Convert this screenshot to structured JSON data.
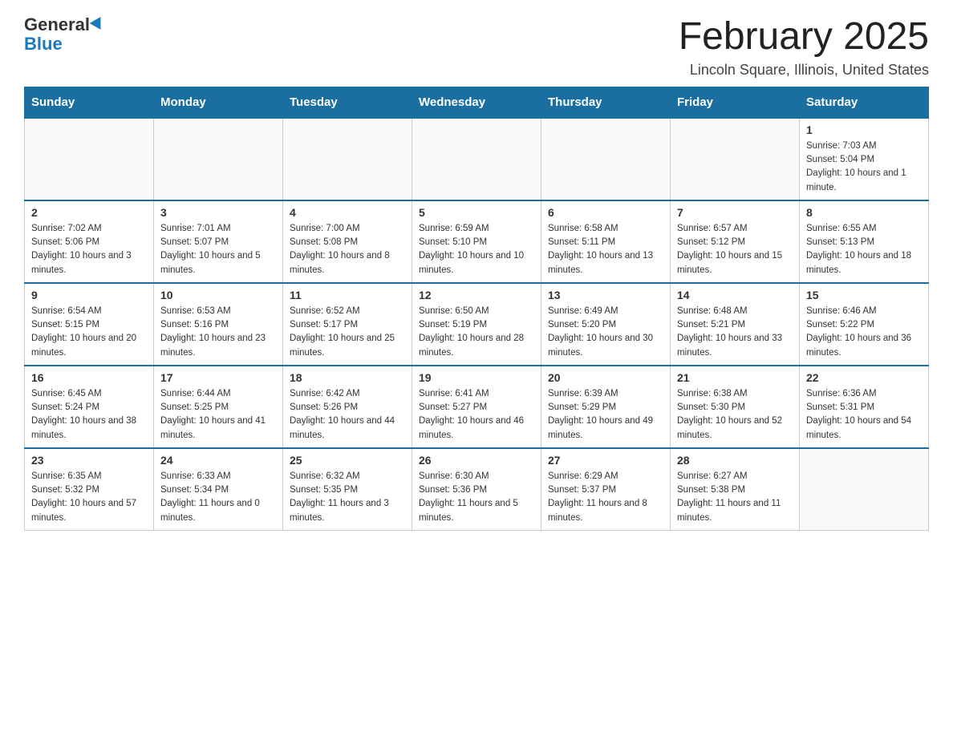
{
  "logo": {
    "name": "General",
    "name2": "Blue"
  },
  "title": "February 2025",
  "location": "Lincoln Square, Illinois, United States",
  "days_of_week": [
    "Sunday",
    "Monday",
    "Tuesday",
    "Wednesday",
    "Thursday",
    "Friday",
    "Saturday"
  ],
  "weeks": [
    [
      {
        "day": "",
        "info": ""
      },
      {
        "day": "",
        "info": ""
      },
      {
        "day": "",
        "info": ""
      },
      {
        "day": "",
        "info": ""
      },
      {
        "day": "",
        "info": ""
      },
      {
        "day": "",
        "info": ""
      },
      {
        "day": "1",
        "info": "Sunrise: 7:03 AM\nSunset: 5:04 PM\nDaylight: 10 hours and 1 minute."
      }
    ],
    [
      {
        "day": "2",
        "info": "Sunrise: 7:02 AM\nSunset: 5:06 PM\nDaylight: 10 hours and 3 minutes."
      },
      {
        "day": "3",
        "info": "Sunrise: 7:01 AM\nSunset: 5:07 PM\nDaylight: 10 hours and 5 minutes."
      },
      {
        "day": "4",
        "info": "Sunrise: 7:00 AM\nSunset: 5:08 PM\nDaylight: 10 hours and 8 minutes."
      },
      {
        "day": "5",
        "info": "Sunrise: 6:59 AM\nSunset: 5:10 PM\nDaylight: 10 hours and 10 minutes."
      },
      {
        "day": "6",
        "info": "Sunrise: 6:58 AM\nSunset: 5:11 PM\nDaylight: 10 hours and 13 minutes."
      },
      {
        "day": "7",
        "info": "Sunrise: 6:57 AM\nSunset: 5:12 PM\nDaylight: 10 hours and 15 minutes."
      },
      {
        "day": "8",
        "info": "Sunrise: 6:55 AM\nSunset: 5:13 PM\nDaylight: 10 hours and 18 minutes."
      }
    ],
    [
      {
        "day": "9",
        "info": "Sunrise: 6:54 AM\nSunset: 5:15 PM\nDaylight: 10 hours and 20 minutes."
      },
      {
        "day": "10",
        "info": "Sunrise: 6:53 AM\nSunset: 5:16 PM\nDaylight: 10 hours and 23 minutes."
      },
      {
        "day": "11",
        "info": "Sunrise: 6:52 AM\nSunset: 5:17 PM\nDaylight: 10 hours and 25 minutes."
      },
      {
        "day": "12",
        "info": "Sunrise: 6:50 AM\nSunset: 5:19 PM\nDaylight: 10 hours and 28 minutes."
      },
      {
        "day": "13",
        "info": "Sunrise: 6:49 AM\nSunset: 5:20 PM\nDaylight: 10 hours and 30 minutes."
      },
      {
        "day": "14",
        "info": "Sunrise: 6:48 AM\nSunset: 5:21 PM\nDaylight: 10 hours and 33 minutes."
      },
      {
        "day": "15",
        "info": "Sunrise: 6:46 AM\nSunset: 5:22 PM\nDaylight: 10 hours and 36 minutes."
      }
    ],
    [
      {
        "day": "16",
        "info": "Sunrise: 6:45 AM\nSunset: 5:24 PM\nDaylight: 10 hours and 38 minutes."
      },
      {
        "day": "17",
        "info": "Sunrise: 6:44 AM\nSunset: 5:25 PM\nDaylight: 10 hours and 41 minutes."
      },
      {
        "day": "18",
        "info": "Sunrise: 6:42 AM\nSunset: 5:26 PM\nDaylight: 10 hours and 44 minutes."
      },
      {
        "day": "19",
        "info": "Sunrise: 6:41 AM\nSunset: 5:27 PM\nDaylight: 10 hours and 46 minutes."
      },
      {
        "day": "20",
        "info": "Sunrise: 6:39 AM\nSunset: 5:29 PM\nDaylight: 10 hours and 49 minutes."
      },
      {
        "day": "21",
        "info": "Sunrise: 6:38 AM\nSunset: 5:30 PM\nDaylight: 10 hours and 52 minutes."
      },
      {
        "day": "22",
        "info": "Sunrise: 6:36 AM\nSunset: 5:31 PM\nDaylight: 10 hours and 54 minutes."
      }
    ],
    [
      {
        "day": "23",
        "info": "Sunrise: 6:35 AM\nSunset: 5:32 PM\nDaylight: 10 hours and 57 minutes."
      },
      {
        "day": "24",
        "info": "Sunrise: 6:33 AM\nSunset: 5:34 PM\nDaylight: 11 hours and 0 minutes."
      },
      {
        "day": "25",
        "info": "Sunrise: 6:32 AM\nSunset: 5:35 PM\nDaylight: 11 hours and 3 minutes."
      },
      {
        "day": "26",
        "info": "Sunrise: 6:30 AM\nSunset: 5:36 PM\nDaylight: 11 hours and 5 minutes."
      },
      {
        "day": "27",
        "info": "Sunrise: 6:29 AM\nSunset: 5:37 PM\nDaylight: 11 hours and 8 minutes."
      },
      {
        "day": "28",
        "info": "Sunrise: 6:27 AM\nSunset: 5:38 PM\nDaylight: 11 hours and 11 minutes."
      },
      {
        "day": "",
        "info": ""
      }
    ]
  ]
}
